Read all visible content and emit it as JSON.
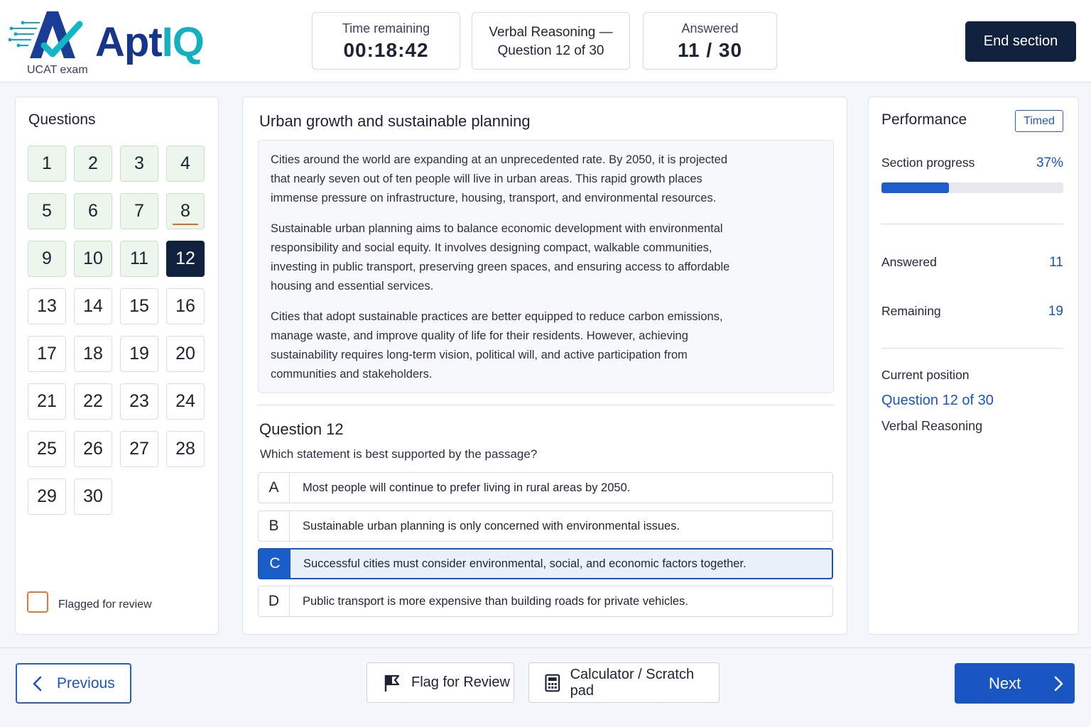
{
  "brand": {
    "name_main": "Apt",
    "name_accent": "IQ",
    "subtitle": "UCAT exam"
  },
  "header": {
    "timer_label": "Time remaining",
    "timer_value": "00:18:42",
    "section_line1": "Verbal Reasoning —",
    "section_line2": "Question 12 of 30",
    "answered_label": "Answered",
    "answered_value": "11 / 30",
    "end_section_label": "End section"
  },
  "questions_panel": {
    "title": "Questions",
    "items": [
      {
        "n": "1",
        "state": "answered"
      },
      {
        "n": "2",
        "state": "answered"
      },
      {
        "n": "3",
        "state": "answered"
      },
      {
        "n": "4",
        "state": "answered"
      },
      {
        "n": "5",
        "state": "answered"
      },
      {
        "n": "6",
        "state": "answered"
      },
      {
        "n": "7",
        "state": "answered"
      },
      {
        "n": "8",
        "state": "flagged"
      },
      {
        "n": "9",
        "state": "answered"
      },
      {
        "n": "10",
        "state": "answered"
      },
      {
        "n": "11",
        "state": "answered"
      },
      {
        "n": "12",
        "state": "current"
      },
      {
        "n": "13",
        "state": "unanswered"
      },
      {
        "n": "14",
        "state": "unanswered"
      },
      {
        "n": "15",
        "state": "unanswered"
      },
      {
        "n": "16",
        "state": "unanswered"
      },
      {
        "n": "17",
        "state": "unanswered"
      },
      {
        "n": "18",
        "state": "unanswered"
      },
      {
        "n": "19",
        "state": "unanswered"
      },
      {
        "n": "20",
        "state": "unanswered"
      },
      {
        "n": "21",
        "state": "unanswered"
      },
      {
        "n": "22",
        "state": "unanswered"
      },
      {
        "n": "23",
        "state": "unanswered"
      },
      {
        "n": "24",
        "state": "unanswered"
      },
      {
        "n": "25",
        "state": "unanswered"
      },
      {
        "n": "26",
        "state": "unanswered"
      },
      {
        "n": "27",
        "state": "unanswered"
      },
      {
        "n": "28",
        "state": "unanswered"
      },
      {
        "n": "29",
        "state": "unanswered"
      },
      {
        "n": "30",
        "state": "unanswered"
      }
    ],
    "legend_flagged": "Flagged for review"
  },
  "passage": {
    "title": "Urban growth and sustainable planning",
    "paragraphs": [
      "Cities around the world are expanding at an unprecedented rate. By 2050, it is projected that nearly seven out of ten people will live in urban areas. This rapid growth places immense pressure on infrastructure, housing, transport, and environmental resources.",
      "Sustainable urban planning aims to balance economic development with environmental responsibility and social equity. It involves designing compact, walkable communities, investing in public transport, preserving green spaces, and ensuring access to affordable housing and essential services.",
      "Cities that adopt sustainable practices are better equipped to reduce carbon emissions, manage waste, and improve quality of life for their residents. However, achieving sustainability requires long-term vision, political will, and active participation from communities and stakeholders."
    ]
  },
  "question": {
    "title": "Question 12",
    "prompt": "Which statement is best supported by the passage?",
    "options": [
      {
        "letter": "A",
        "text": "Most people will continue to prefer living in rural areas by 2050.",
        "selected": false
      },
      {
        "letter": "B",
        "text": "Sustainable urban planning is only concerned with environmental issues.",
        "selected": false
      },
      {
        "letter": "C",
        "text": "Successful cities must consider environmental, social, and economic factors together.",
        "selected": true
      },
      {
        "letter": "D",
        "text": "Public transport is more expensive than building roads for private vehicles.",
        "selected": false
      }
    ]
  },
  "performance": {
    "title": "Performance",
    "mode_badge": "Timed",
    "progress_label": "Section progress",
    "progress_value": "37%",
    "progress_fraction": 0.37,
    "answered_label": "Answered",
    "answered_value": "11",
    "remaining_label": "Remaining",
    "remaining_value": "19",
    "position_label": "Current position",
    "position_value": "Question 12 of 30",
    "position_section": "Verbal Reasoning"
  },
  "footer": {
    "previous_label": "Previous",
    "flag_label": "Flag for Review",
    "calculator_label": "Calculator / Scratch pad",
    "next_label": "Next"
  },
  "colors": {
    "primary": "#1a56c2",
    "navy": "#10213d",
    "answered_bg": "#edf6ec",
    "flag_orange": "#e46a17",
    "brand_teal": "#13b0bf"
  }
}
